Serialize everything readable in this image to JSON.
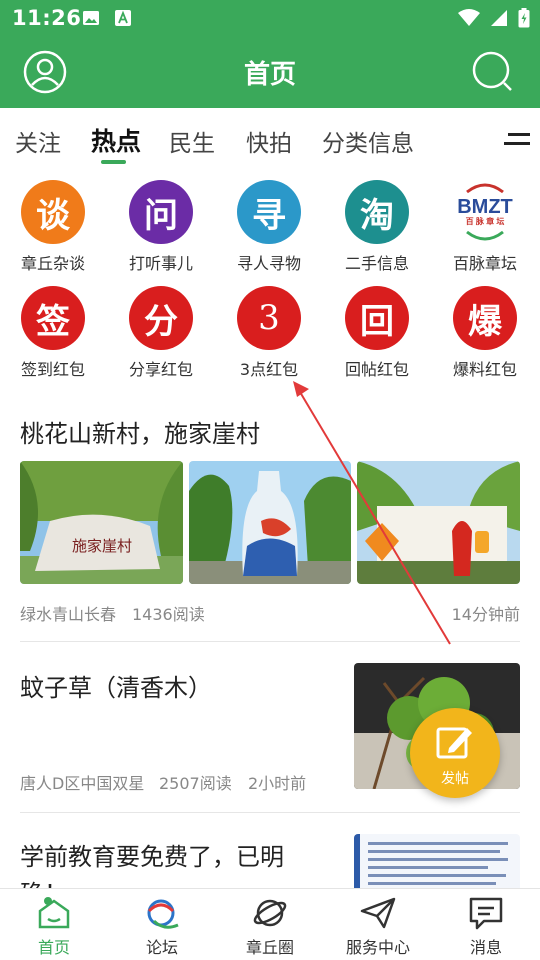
{
  "status": {
    "time": "11:26"
  },
  "header": {
    "title": "首页"
  },
  "tabs": [
    {
      "label": "关注"
    },
    {
      "label": "热点"
    },
    {
      "label": "民生"
    },
    {
      "label": "快拍"
    },
    {
      "label": "分类信息"
    }
  ],
  "grid": [
    {
      "label": "章丘杂谈",
      "glyph": "谈",
      "color": "#f07b1a"
    },
    {
      "label": "打听事儿",
      "glyph": "问",
      "color": "#6b2ca6"
    },
    {
      "label": "寻人寻物",
      "glyph": "寻",
      "color": "#2b98c9"
    },
    {
      "label": "二手信息",
      "glyph": "淘",
      "color": "#1d8f8f"
    },
    {
      "label": "百脉章坛",
      "glyph": "BMZT",
      "sub": "百 脉 章 坛"
    },
    {
      "label": "签到红包",
      "glyph": "签"
    },
    {
      "label": "分享红包",
      "glyph": "分"
    },
    {
      "label": "3点红包",
      "glyph": "3"
    },
    {
      "label": "回帖红包",
      "glyph": "回"
    },
    {
      "label": "爆料红包",
      "glyph": "爆"
    }
  ],
  "articles": [
    {
      "title": "桃花山新村，施家崖村",
      "author": "绿水青山长春",
      "reads": "1436阅读",
      "time": "14分钟前",
      "photo_text": "施家崖村"
    },
    {
      "title": "蚊子草（清香木）",
      "author": "唐人D区中国双星",
      "reads": "2507阅读",
      "time": "2小时前"
    },
    {
      "title_line1": "学前教育要免费了，已明",
      "title_line2": "确！"
    }
  ],
  "fab": {
    "label": "发帖"
  },
  "bottom_nav": [
    {
      "label": "首页"
    },
    {
      "label": "论坛"
    },
    {
      "label": "章丘圈"
    },
    {
      "label": "服务中心"
    },
    {
      "label": "消息"
    }
  ],
  "colors": {
    "brand": "#3aa95a",
    "fab": "#f2b51b",
    "red": "#d91e1e"
  }
}
